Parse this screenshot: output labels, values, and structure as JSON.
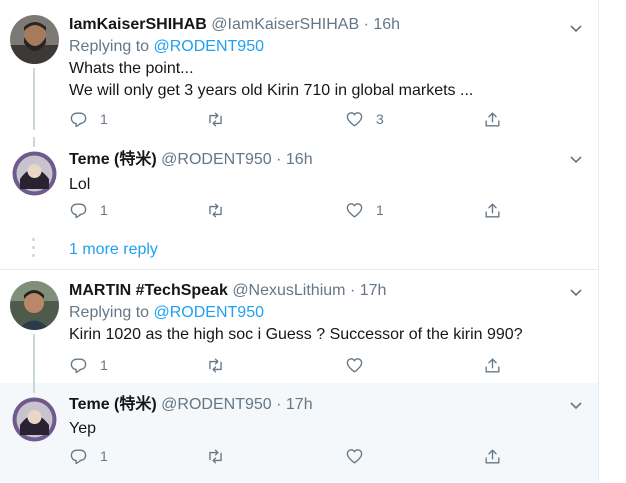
{
  "tweets": [
    {
      "name": "IamKaiserSHIHAB",
      "handle": "@IamKaiserSHIHAB",
      "time": "16h",
      "replying_label": "Replying to",
      "replying_to": "@RODENT950",
      "lines": [
        "Whats the point...",
        "We will only get 3 years old Kirin 710 in global markets ..."
      ],
      "replies": "1",
      "retweets": "",
      "likes": "3"
    },
    {
      "name": "Teme (特米)",
      "handle": "@RODENT950",
      "time": "16h",
      "lines": [
        "Lol"
      ],
      "replies": "1",
      "retweets": "",
      "likes": "1"
    },
    {
      "name": "MARTIN #TechSpeak",
      "handle": "@NexusLithium",
      "time": "17h",
      "replying_label": "Replying to",
      "replying_to": "@RODENT950",
      "lines": [
        "Kirin 1020 as the high soc i Guess ? Successor of the kirin 990?"
      ],
      "replies": "1",
      "retweets": "",
      "likes": ""
    },
    {
      "name": "Teme (特米)",
      "handle": "@RODENT950",
      "time": "17h",
      "lines": [
        "Yep"
      ],
      "replies": "1",
      "retweets": "",
      "likes": ""
    }
  ],
  "more_reply": "1 more reply",
  "separator": "·",
  "colors": {
    "accent": "#1da1f2",
    "secondary": "#657786",
    "line": "#ccd6dd"
  }
}
